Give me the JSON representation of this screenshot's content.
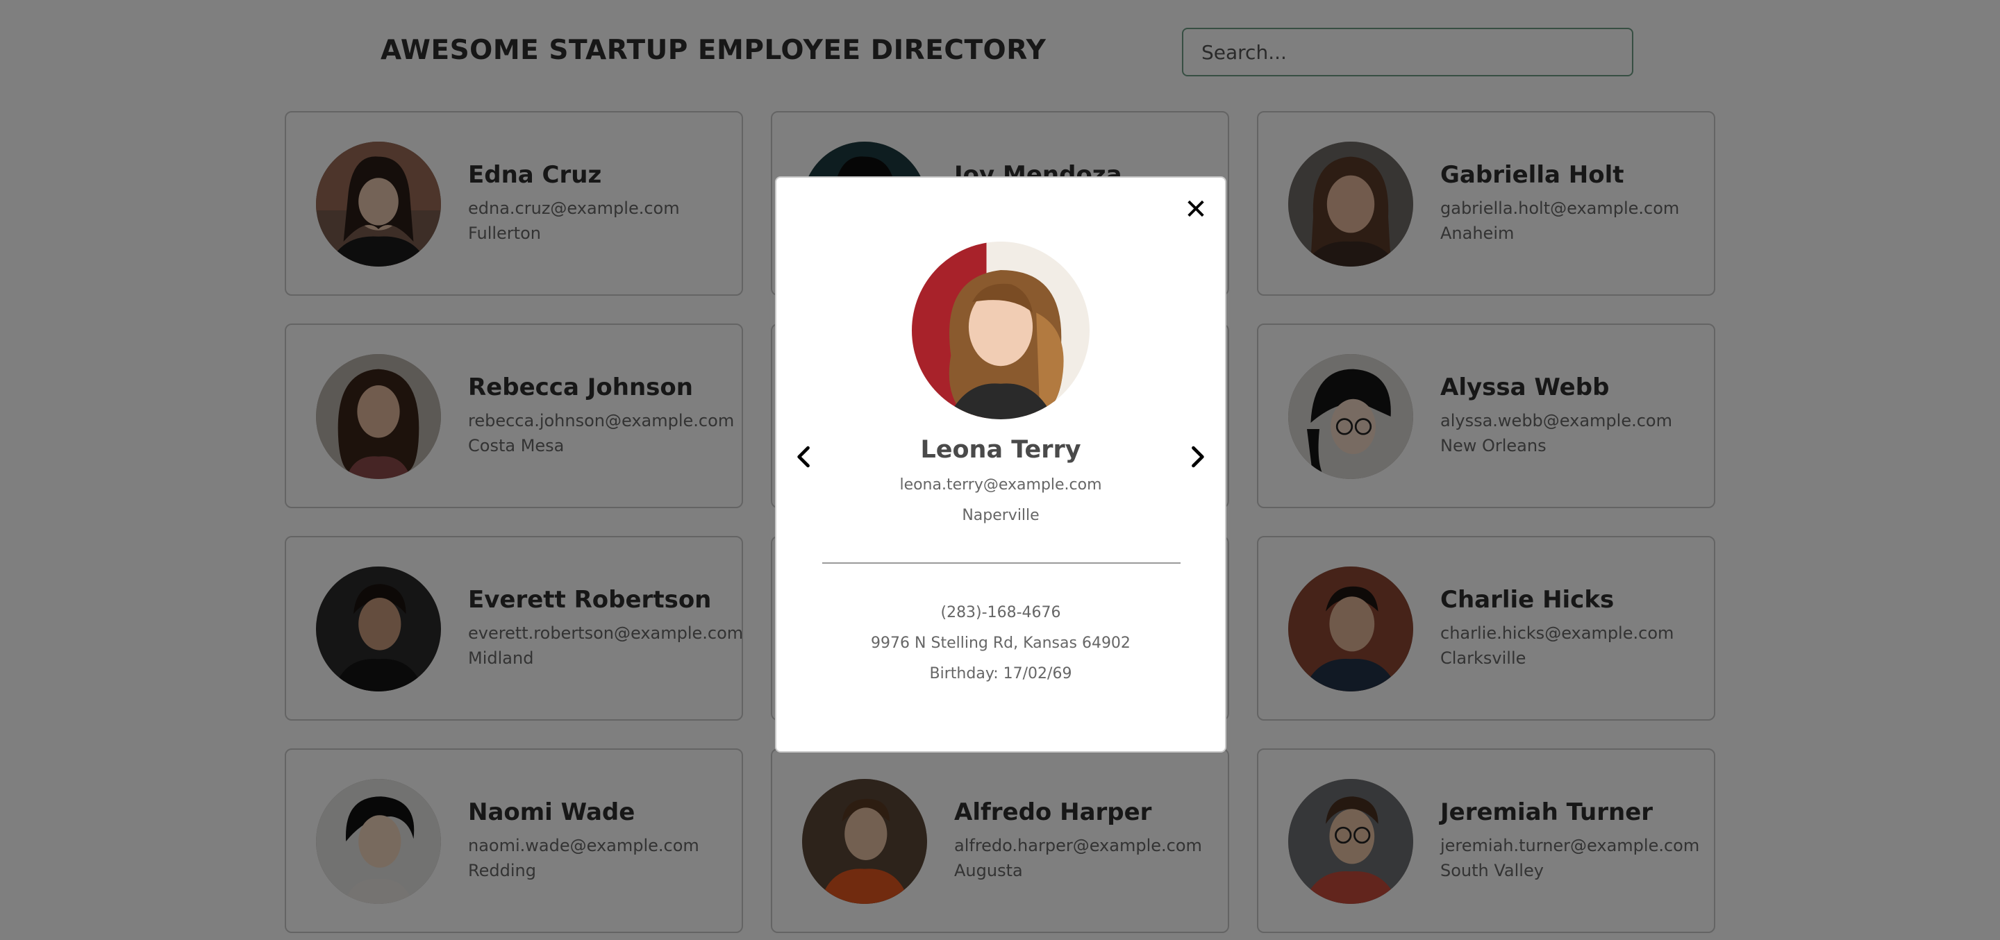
{
  "header": {
    "title": "AWESOME STARTUP EMPLOYEE DIRECTORY",
    "search_placeholder": "Search..."
  },
  "employees": [
    {
      "name": "Edna Cruz",
      "email": "edna.cruz@example.com",
      "city": "Fullerton"
    },
    {
      "name": "Joy Mendoza",
      "email": "",
      "city": ""
    },
    {
      "name": "Gabriella Holt",
      "email": "gabriella.holt@example.com",
      "city": "Anaheim"
    },
    {
      "name": "Rebecca Johnson",
      "email": "rebecca.johnson@example.com",
      "city": "Costa Mesa"
    },
    {
      "name": "",
      "email": "",
      "city": ""
    },
    {
      "name": "Alyssa Webb",
      "email": "alyssa.webb@example.com",
      "city": "New Orleans"
    },
    {
      "name": "Everett Robertson",
      "email": "everett.robertson@example.com",
      "city": "Midland"
    },
    {
      "name": "",
      "email": "",
      "city": ""
    },
    {
      "name": "Charlie Hicks",
      "email": "charlie.hicks@example.com",
      "city": "Clarksville"
    },
    {
      "name": "Naomi Wade",
      "email": "naomi.wade@example.com",
      "city": "Redding"
    },
    {
      "name": "Alfredo Harper",
      "email": "alfredo.harper@example.com",
      "city": "Augusta"
    },
    {
      "name": "Jeremiah Turner",
      "email": "jeremiah.turner@example.com",
      "city": "South Valley"
    }
  ],
  "modal": {
    "close_icon": "close-icon",
    "prev_icon": "chevron-left-icon",
    "next_icon": "chevron-right-icon",
    "name": "Leona Terry",
    "email": "leona.terry@example.com",
    "city": "Naperville",
    "phone": "(283)-168-4676",
    "address": "9976 N Stelling Rd, Kansas 64902",
    "birthday": "Birthday: 17/02/69"
  },
  "colors": {
    "overlay": "#00000080",
    "search_border": "#6e9e86",
    "card_border": "#c9c9c9"
  }
}
